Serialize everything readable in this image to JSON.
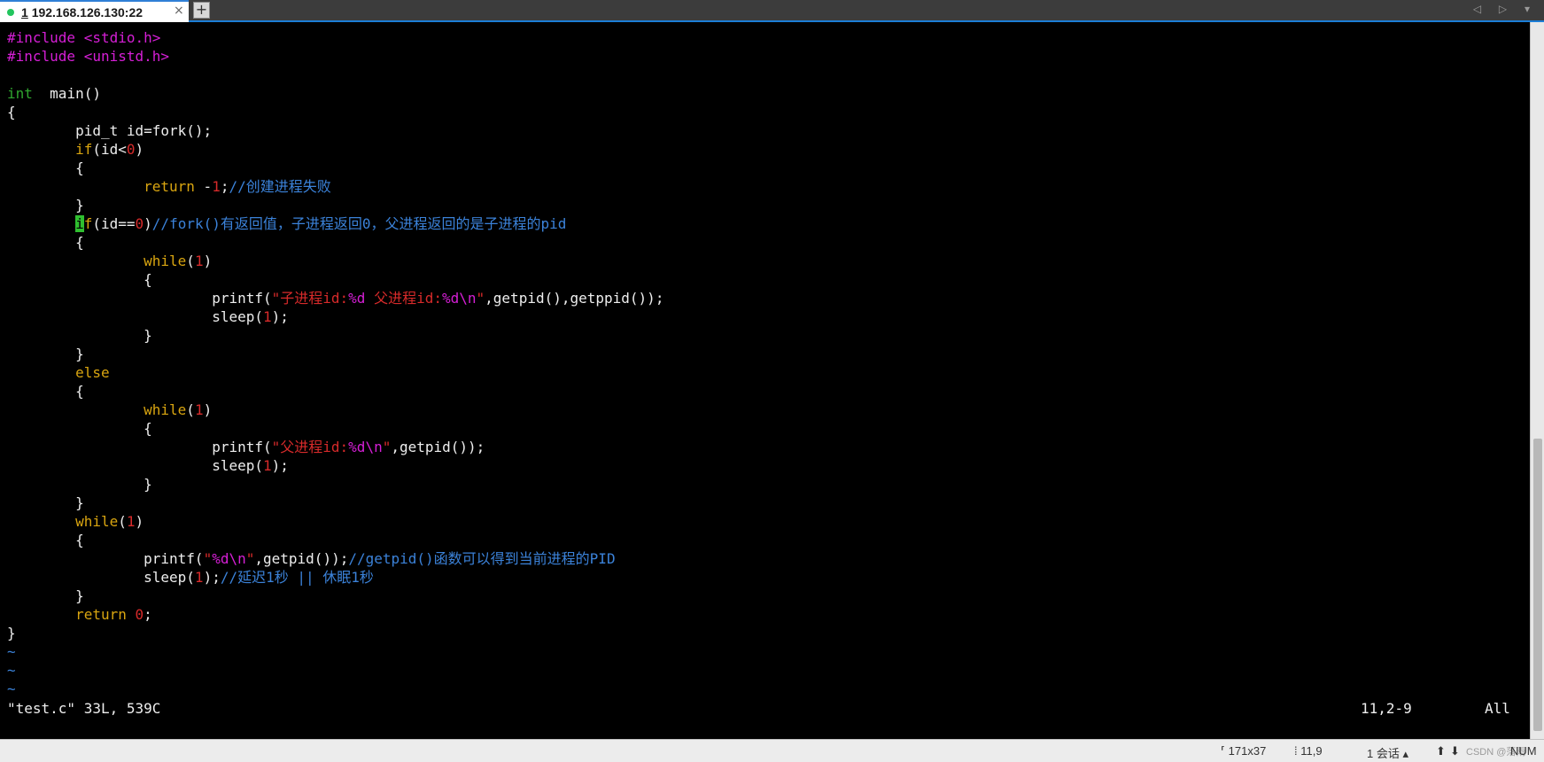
{
  "tab": {
    "index": "1",
    "host": "192.168.126.130:22",
    "close": "×",
    "new_tab": "+",
    "nav": "◁ ▷ ▾"
  },
  "colors": {
    "preprocessor": "#d61fd6",
    "type": "#2fa52f",
    "keyword": "#d9a510",
    "number": "#d72a2a",
    "string": "#d72a2a",
    "comment": "#3b82d9",
    "cursor_bg": "#2fbf2f",
    "tab_accent": "#1c7ed6"
  },
  "code": [
    [
      [
        "pre",
        "#include "
      ],
      [
        "pre",
        "<stdio.h>"
      ]
    ],
    [
      [
        "pre",
        "#include "
      ],
      [
        "pre",
        "<unistd.h>"
      ]
    ],
    [],
    [
      [
        "type",
        "int"
      ],
      [
        "",
        "  main()"
      ]
    ],
    [
      [
        "",
        "{"
      ]
    ],
    [
      [
        "",
        "        pid_t id=fork();"
      ]
    ],
    [
      [
        "",
        "        "
      ],
      [
        "kw",
        "if"
      ],
      [
        "",
        "(id<"
      ],
      [
        "num",
        "0"
      ],
      [
        "",
        ")"
      ]
    ],
    [
      [
        "",
        "        {"
      ]
    ],
    [
      [
        "",
        "                "
      ],
      [
        "kw",
        "return"
      ],
      [
        "",
        " -"
      ],
      [
        "num",
        "1"
      ],
      [
        "",
        ";"
      ],
      [
        "cmt",
        "//创建进程失败"
      ]
    ],
    [
      [
        "",
        "        }"
      ]
    ],
    [
      [
        "",
        "        "
      ],
      [
        "cursor",
        "i"
      ],
      [
        "kw",
        "f"
      ],
      [
        "",
        "(id=="
      ],
      [
        "num",
        "0"
      ],
      [
        "",
        ")"
      ],
      [
        "cmt",
        "//fork()有返回值，子进程返回0，父进程返回的是子进程的pid"
      ]
    ],
    [
      [
        "",
        "        {"
      ]
    ],
    [
      [
        "",
        "                "
      ],
      [
        "kw",
        "while"
      ],
      [
        "",
        "("
      ],
      [
        "num",
        "1"
      ],
      [
        "",
        ")"
      ]
    ],
    [
      [
        "",
        "                {"
      ]
    ],
    [
      [
        "",
        "                        printf("
      ],
      [
        "str",
        "\"子进程id:"
      ],
      [
        "esc",
        "%d"
      ],
      [
        "str",
        " 父进程id:"
      ],
      [
        "esc",
        "%d\\n"
      ],
      [
        "str",
        "\""
      ],
      [
        "",
        ",getpid(),getppid());"
      ]
    ],
    [
      [
        "",
        "                        sleep("
      ],
      [
        "num",
        "1"
      ],
      [
        "",
        ");"
      ]
    ],
    [
      [
        "",
        "                }"
      ]
    ],
    [
      [
        "",
        "        }"
      ]
    ],
    [
      [
        "",
        "        "
      ],
      [
        "kw",
        "else"
      ]
    ],
    [
      [
        "",
        "        {"
      ]
    ],
    [
      [
        "",
        "                "
      ],
      [
        "kw",
        "while"
      ],
      [
        "",
        "("
      ],
      [
        "num",
        "1"
      ],
      [
        "",
        ")"
      ]
    ],
    [
      [
        "",
        "                {"
      ]
    ],
    [
      [
        "",
        "                        printf("
      ],
      [
        "str",
        "\"父进程id:"
      ],
      [
        "esc",
        "%d\\n"
      ],
      [
        "str",
        "\""
      ],
      [
        "",
        ",getpid());"
      ]
    ],
    [
      [
        "",
        "                        sleep("
      ],
      [
        "num",
        "1"
      ],
      [
        "",
        ");"
      ]
    ],
    [
      [
        "",
        "                }"
      ]
    ],
    [
      [
        "",
        "        }"
      ]
    ],
    [
      [
        "",
        "        "
      ],
      [
        "kw",
        "while"
      ],
      [
        "",
        "("
      ],
      [
        "num",
        "1"
      ],
      [
        "",
        ")"
      ]
    ],
    [
      [
        "",
        "        {"
      ]
    ],
    [
      [
        "",
        "                printf("
      ],
      [
        "str",
        "\""
      ],
      [
        "esc",
        "%d\\n"
      ],
      [
        "str",
        "\""
      ],
      [
        "",
        ",getpid());"
      ],
      [
        "cmt",
        "//getpid()函数可以得到当前进程的PID"
      ]
    ],
    [
      [
        "",
        "                sleep("
      ],
      [
        "num",
        "1"
      ],
      [
        "",
        ");"
      ],
      [
        "cmt",
        "//延迟1秒 || 休眠1秒"
      ]
    ],
    [
      [
        "",
        "        }"
      ]
    ],
    [
      [
        "",
        "        "
      ],
      [
        "kw",
        "return"
      ],
      [
        "",
        " "
      ],
      [
        "num",
        "0"
      ],
      [
        "",
        ";"
      ]
    ],
    [
      [
        "",
        "}"
      ]
    ],
    [
      [
        "tilde",
        "~"
      ]
    ],
    [
      [
        "tilde",
        "~"
      ]
    ],
    [
      [
        "tilde",
        "~"
      ]
    ]
  ],
  "vim": {
    "file_info": "\"test.c\" 33L, 539C",
    "position": "11,2-9",
    "scroll": "All"
  },
  "statusbar": {
    "size": "⸢ 171x37",
    "cursor": "⁞ 11,9",
    "sessions": "1 会话 ▴",
    "arrow_up": "⬆",
    "arrow_down": "⬇",
    "credit": "CSDN @落雨",
    "num": "NUM"
  }
}
